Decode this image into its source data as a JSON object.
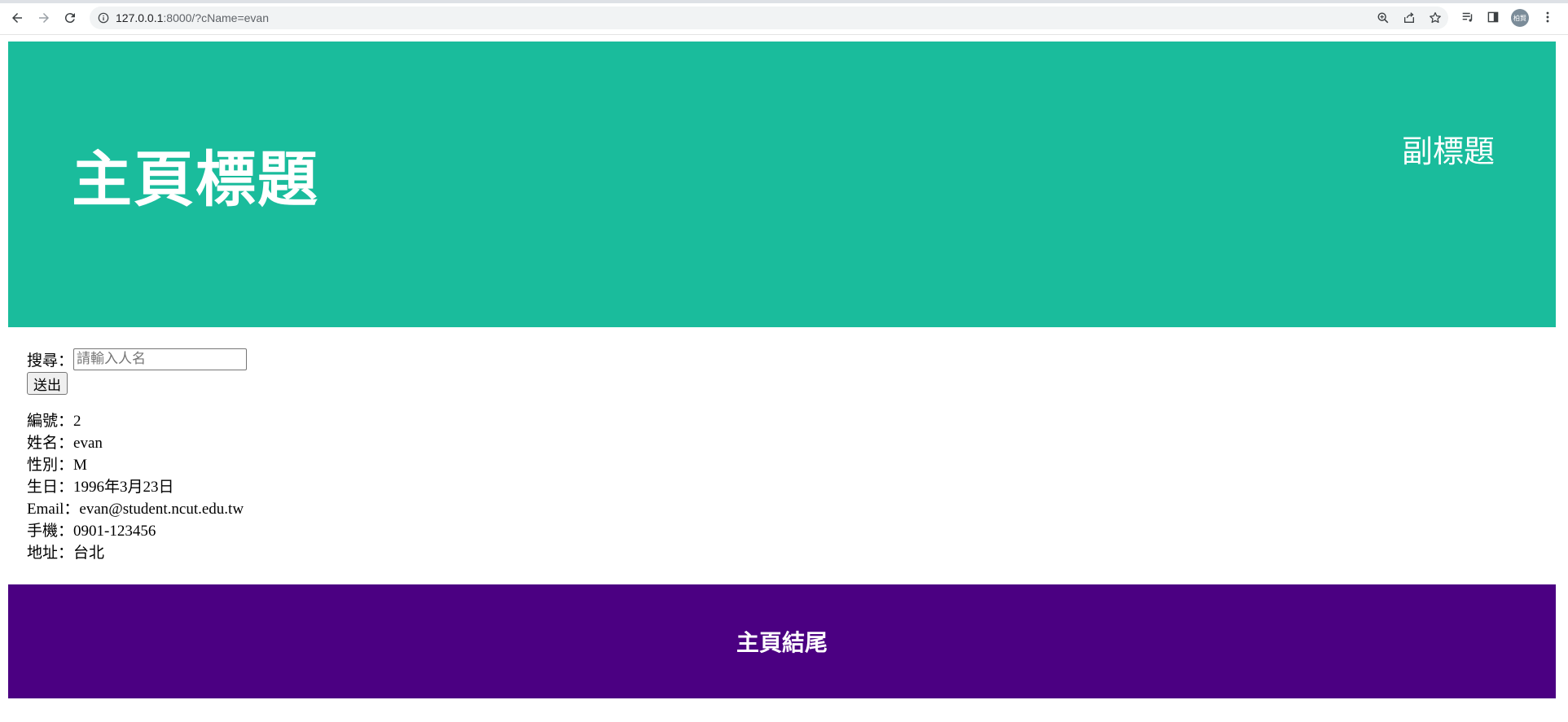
{
  "browser": {
    "url_host": "127.0.0.1",
    "url_rest": ":8000/?cName=evan",
    "avatar_text": "柏賢",
    "icons": [
      "back-arrow-icon",
      "forward-arrow-icon",
      "reload-icon",
      "info-icon",
      "zoom-icon",
      "share-icon",
      "star-icon",
      "reading-list-icon",
      "side-panel-icon",
      "menu-kebab-icon"
    ]
  },
  "header": {
    "title": "主頁標題",
    "subtitle": "副標題",
    "bg_color": "#1abc9c"
  },
  "search": {
    "label": "搜尋：",
    "placeholder": "請輸入人名",
    "value": "",
    "submit_label": "送出"
  },
  "record": {
    "rows": [
      {
        "label": "編號：",
        "value": "2"
      },
      {
        "label": "姓名：",
        "value": "evan"
      },
      {
        "label": "性別：",
        "value": "M"
      },
      {
        "label": "生日：",
        "value": "1996年3月23日"
      },
      {
        "label": "Email：",
        "value": "evan@student.ncut.edu.tw"
      },
      {
        "label": "手機：",
        "value": "0901-123456"
      },
      {
        "label": "地址：",
        "value": "台北"
      }
    ]
  },
  "footer": {
    "text": "主頁結尾",
    "bg_color": "#4b0082"
  }
}
